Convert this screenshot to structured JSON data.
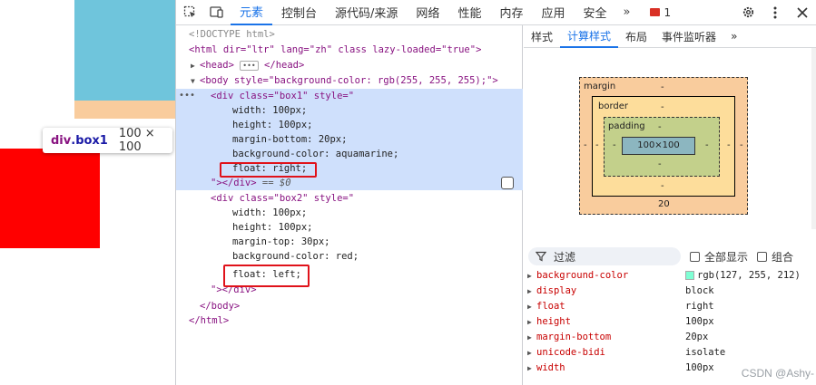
{
  "colors": {
    "accent": "#1a73e8",
    "box1": "#6fc5dc",
    "margin": "#f9cc9d",
    "box2": "#ff0000",
    "swatch": "#7fffd4"
  },
  "tooltip": {
    "tag": "div",
    "cls": ".box1",
    "size": "100 × 100"
  },
  "tabs": [
    "元素",
    "控制台",
    "源代码/来源",
    "网络",
    "性能",
    "内存",
    "应用",
    "安全"
  ],
  "issues_count": "1",
  "dom": {
    "l0": "<!DOCTYPE html>",
    "html_open": "<html dir=\"ltr\" lang=\"zh\" class lazy-loaded=\"true\">",
    "head_open": "<head>",
    "head_close": "</head>",
    "body_open": "<body style=\"background-color: rgb(255, 255, 255);\">",
    "box1_open": "<div class=\"box1\" style=\"",
    "box1_w": "width: 100px;",
    "box1_h": "height: 100px;",
    "box1_mb": "margin-bottom: 20px;",
    "box1_bg": "background-color: aquamarine;",
    "box1_float": "float: right;",
    "box1_close": "\"></div>",
    "eq0": "== $0",
    "box2_open": "<div class=\"box2\" style=\"",
    "box2_w": "width: 100px;",
    "box2_h": "height: 100px;",
    "box2_mt": "margin-top: 30px;",
    "box2_bg": "background-color: red;",
    "box2_float": "float: left;",
    "box2_close": "\"></div>",
    "body_close": "</body>",
    "html_close": "</html>"
  },
  "subtabs": [
    "样式",
    "计算样式",
    "布局",
    "事件监听器"
  ],
  "boxmodel": {
    "margin_label": "margin",
    "margin_top": "-",
    "margin_left": "-",
    "margin_right": "-",
    "margin_bottom": "20",
    "border_label": "border",
    "border_top": "-",
    "border_left": "-",
    "border_right": "-",
    "border_bottom": "-",
    "padding_label": "padding",
    "padding_top": "-",
    "padding_left": "-",
    "padding_right": "-",
    "padding_bottom": "-",
    "content": "100×100"
  },
  "filter": {
    "placeholder": "过滤",
    "show_all": "全部显示",
    "group": "组合"
  },
  "computed": [
    {
      "name": "background-color",
      "value": "rgb(127, 255, 212)"
    },
    {
      "name": "display",
      "value": "block"
    },
    {
      "name": "float",
      "value": "right"
    },
    {
      "name": "height",
      "value": "100px"
    },
    {
      "name": "margin-bottom",
      "value": "20px"
    },
    {
      "name": "unicode-bidi",
      "value": "isolate"
    },
    {
      "name": "width",
      "value": "100px"
    }
  ],
  "watermark": "CSDN @Ashy-"
}
